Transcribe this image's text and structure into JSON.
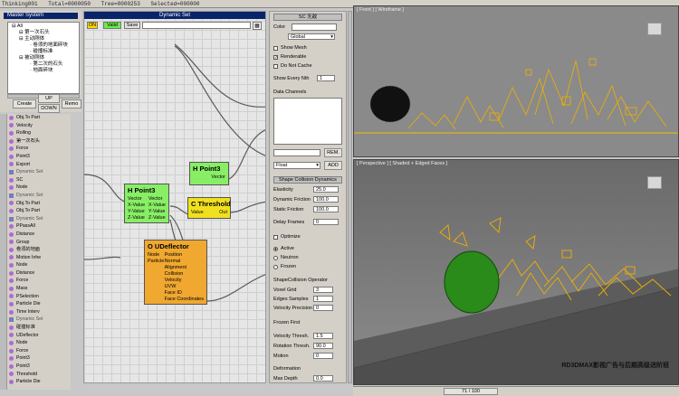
{
  "titlebar": {
    "app": "Thinking001",
    "total": "Total=0000050",
    "tree": "Tree=0000253",
    "selected": "Selected=000000"
  },
  "master": {
    "title": "Master System",
    "items": [
      "All",
      "第一次石头",
      "主动刚体",
      "卷须的地面碎块",
      "碰撞标准",
      "被动刚体",
      "第二次的石头",
      "地面碎块"
    ],
    "buttons": {
      "create": "Create",
      "up": "UP",
      "down": "DOWN",
      "remove": "Remo"
    }
  },
  "oplist": [
    {
      "label": "Obj.To Part",
      "color": "#b06ad0",
      "set": false
    },
    {
      "label": "Velocity",
      "color": "#b06ad0",
      "set": false
    },
    {
      "label": "Rolling",
      "color": "#b06ad0",
      "set": false
    },
    {
      "label": "第一次石头",
      "color": "#b06ad0",
      "set": false
    },
    {
      "label": "Force",
      "color": "#b06ad0",
      "set": false
    },
    {
      "label": "Point3",
      "color": "#b06ad0",
      "set": false
    },
    {
      "label": "Export",
      "color": "#b06ad0",
      "set": false
    },
    {
      "label": "Dynamic Set",
      "color": "#7a7ab8",
      "set": true
    },
    {
      "label": "SC",
      "color": "#b06ad0",
      "set": false
    },
    {
      "label": "Node",
      "color": "#b06ad0",
      "set": false
    },
    {
      "label": "Dynamic Set",
      "color": "#7a7ab8",
      "set": true
    },
    {
      "label": "Obj.To Part",
      "color": "#b06ad0",
      "set": false
    },
    {
      "label": "Obj.To Part",
      "color": "#b06ad0",
      "set": false
    },
    {
      "label": "Dynamic Set",
      "color": "#7a7ab8",
      "set": true
    },
    {
      "label": "PPassAll",
      "color": "#b06ad0",
      "set": false
    },
    {
      "label": "Distance",
      "color": "#b06ad0",
      "set": false
    },
    {
      "label": "Group",
      "color": "#b06ad0",
      "set": false
    },
    {
      "label": "卷须的地面",
      "color": "#b06ad0",
      "set": false
    },
    {
      "label": "Motion Inhe",
      "color": "#b06ad0",
      "set": false
    },
    {
      "label": "Node",
      "color": "#b06ad0",
      "set": false
    },
    {
      "label": "Distance",
      "color": "#b06ad0",
      "set": false
    },
    {
      "label": "Force",
      "color": "#b06ad0",
      "set": false
    },
    {
      "label": "Mass",
      "color": "#b06ad0",
      "set": false
    },
    {
      "label": "PSelection",
      "color": "#b06ad0",
      "set": false
    },
    {
      "label": "Particle Die",
      "color": "#b06ad0",
      "set": false
    },
    {
      "label": "Time Interv",
      "color": "#b06ad0",
      "set": false
    },
    {
      "label": "Dynamic Set",
      "color": "#7a7ab8",
      "set": true
    },
    {
      "label": "碰撞标准",
      "color": "#b06ad0",
      "set": false
    },
    {
      "label": "UDeflector",
      "color": "#b06ad0",
      "set": false
    },
    {
      "label": "Node",
      "color": "#b06ad0",
      "set": false
    },
    {
      "label": "Force",
      "color": "#b06ad0",
      "set": false
    },
    {
      "label": "Point3",
      "color": "#b06ad0",
      "set": false
    },
    {
      "label": "Point3",
      "color": "#b06ad0",
      "set": false
    },
    {
      "label": "Threshold",
      "color": "#b06ad0",
      "set": false
    },
    {
      "label": "Particle Die",
      "color": "#b06ad0",
      "set": false
    }
  ],
  "graph": {
    "title": "Dynamic Set",
    "on": "ON",
    "valid": "Valid",
    "save": "Save",
    "nodes": {
      "point3a": {
        "title": "H Point3",
        "out": [
          "Vector"
        ]
      },
      "point3b": {
        "title": "H Point3",
        "left": [
          "Vector",
          "X-Value",
          "Y-Value",
          "Z-Value"
        ],
        "right": [
          "Vector",
          "X-Value",
          "Y-Value",
          "Z-Value"
        ]
      },
      "threshold": {
        "title": "C Threshold",
        "left": [
          "Value"
        ],
        "right": [
          "Out"
        ]
      },
      "udeflector": {
        "title": "O UDeflector",
        "left": [
          "Node",
          "Particle"
        ],
        "right": [
          "Position",
          "Normal",
          "Alignment",
          "Collision",
          "Velocity",
          "UVW",
          "Face ID",
          "Face Coordinates"
        ]
      }
    }
  },
  "rollout": {
    "sc_title": "SC 无敌",
    "color_label": "Color",
    "global": "Global",
    "show_mesh": "Show Mesh",
    "renderable": "Renderable",
    "do_not_cache": "Do Not Cache",
    "show_every_nth": "Show Every Nth",
    "show_every_nth_val": "1",
    "data_channels": "Data Channels",
    "rem": "REM.",
    "float": "Float",
    "add": "ADD",
    "shape_title": "Shape Collision Dynamics",
    "elasticity": "Elasticity",
    "elasticity_val": "25.0",
    "dyn_friction": "Dynamic Friction",
    "dyn_friction_val": "100.0",
    "static_friction": "Static Friction",
    "static_friction_val": "100.0",
    "delay_frames": "Delay Frames",
    "delay_frames_val": "0",
    "optimize": "Optimize",
    "active": "Active",
    "neutron": "Neutron",
    "frozen": "Frozen",
    "operator": "ShapeCollision Operator",
    "voxel_grid": "Voxel Grid",
    "voxel_grid_val": "3",
    "edges_samples": "Edges Samples",
    "edges_samples_val": "1",
    "velocity_precision": "Velocity Precision",
    "velocity_precision_val": "0",
    "frozen_first": "Frozen First",
    "velocity_thresh": "Velocity Thresh.",
    "velocity_thresh_val": "1.5",
    "rotation_thresh": "Rotation Thresh.",
    "rotation_thresh_val": "90.0",
    "motion": "Motion",
    "motion_val": "0",
    "deformation": "Deformation",
    "max_depth": "Max Depth",
    "max_depth_val": "0.0"
  },
  "viewports": {
    "front": "[ Front ] [ Wireframe ]",
    "perspective": "[ Perspective ] [ Shaded + Edged Faces ]",
    "watermark": "RD3DMAX影视广告与后期高级进阶班"
  },
  "status": {
    "frame": "71 / 100"
  }
}
